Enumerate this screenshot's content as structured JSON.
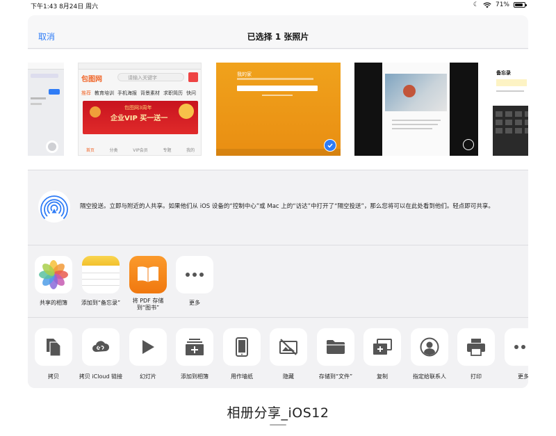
{
  "status_bar": {
    "time_date": "下午1:43   8月24日 周六",
    "battery": "71%"
  },
  "nav": {
    "cancel": "取消",
    "title": "已选择 1 张照片"
  },
  "photos": {
    "thumb2": {
      "brand": "包图网",
      "search_placeholder": "请输入关键字",
      "tabs": [
        "推荐",
        "教育培训",
        "手机海报",
        "背景素材",
        "求职简历",
        "快问"
      ],
      "banner_title": "包图网3周年",
      "banner_main": "企业VIP 买一送一",
      "bottom_nav": [
        "首页",
        "分类",
        "VIP会员",
        "专题",
        "我的"
      ]
    },
    "thumb3": {
      "heading": "我的家"
    },
    "thumb5": {
      "heading": "备忘录"
    }
  },
  "airdrop": {
    "text": "隔空投送。立即与附近的人共享。如果他们从 iOS 设备的“控制中心”或 Mac 上的“访达”中打开了“隔空投送”，那么您将可以在此处看到他们。轻点即可共享。"
  },
  "apps": [
    {
      "label": "共享的相簿"
    },
    {
      "label": "添加到“备忘录”"
    },
    {
      "label_line1": "将 PDF 存储",
      "label_line2": "到“图书”"
    },
    {
      "label": "更多"
    }
  ],
  "actions": [
    {
      "label": "拷贝",
      "icon": "copy-icon"
    },
    {
      "label": "拷贝 iCloud 链接",
      "icon": "link-icon"
    },
    {
      "label": "幻灯片",
      "icon": "play-icon"
    },
    {
      "label": "添加到相簿",
      "icon": "add-album-icon"
    },
    {
      "label": "用作墙纸",
      "icon": "wallpaper-icon"
    },
    {
      "label": "隐藏",
      "icon": "hide-icon"
    },
    {
      "label": "存储到“文件”",
      "icon": "folder-icon"
    },
    {
      "label": "复制",
      "icon": "duplicate-icon"
    },
    {
      "label": "指定给联系人",
      "icon": "contact-icon"
    },
    {
      "label": "打印",
      "icon": "print-icon"
    },
    {
      "label": "更多",
      "icon": "more-icon"
    }
  ],
  "caption": "相册分享_iOS12"
}
